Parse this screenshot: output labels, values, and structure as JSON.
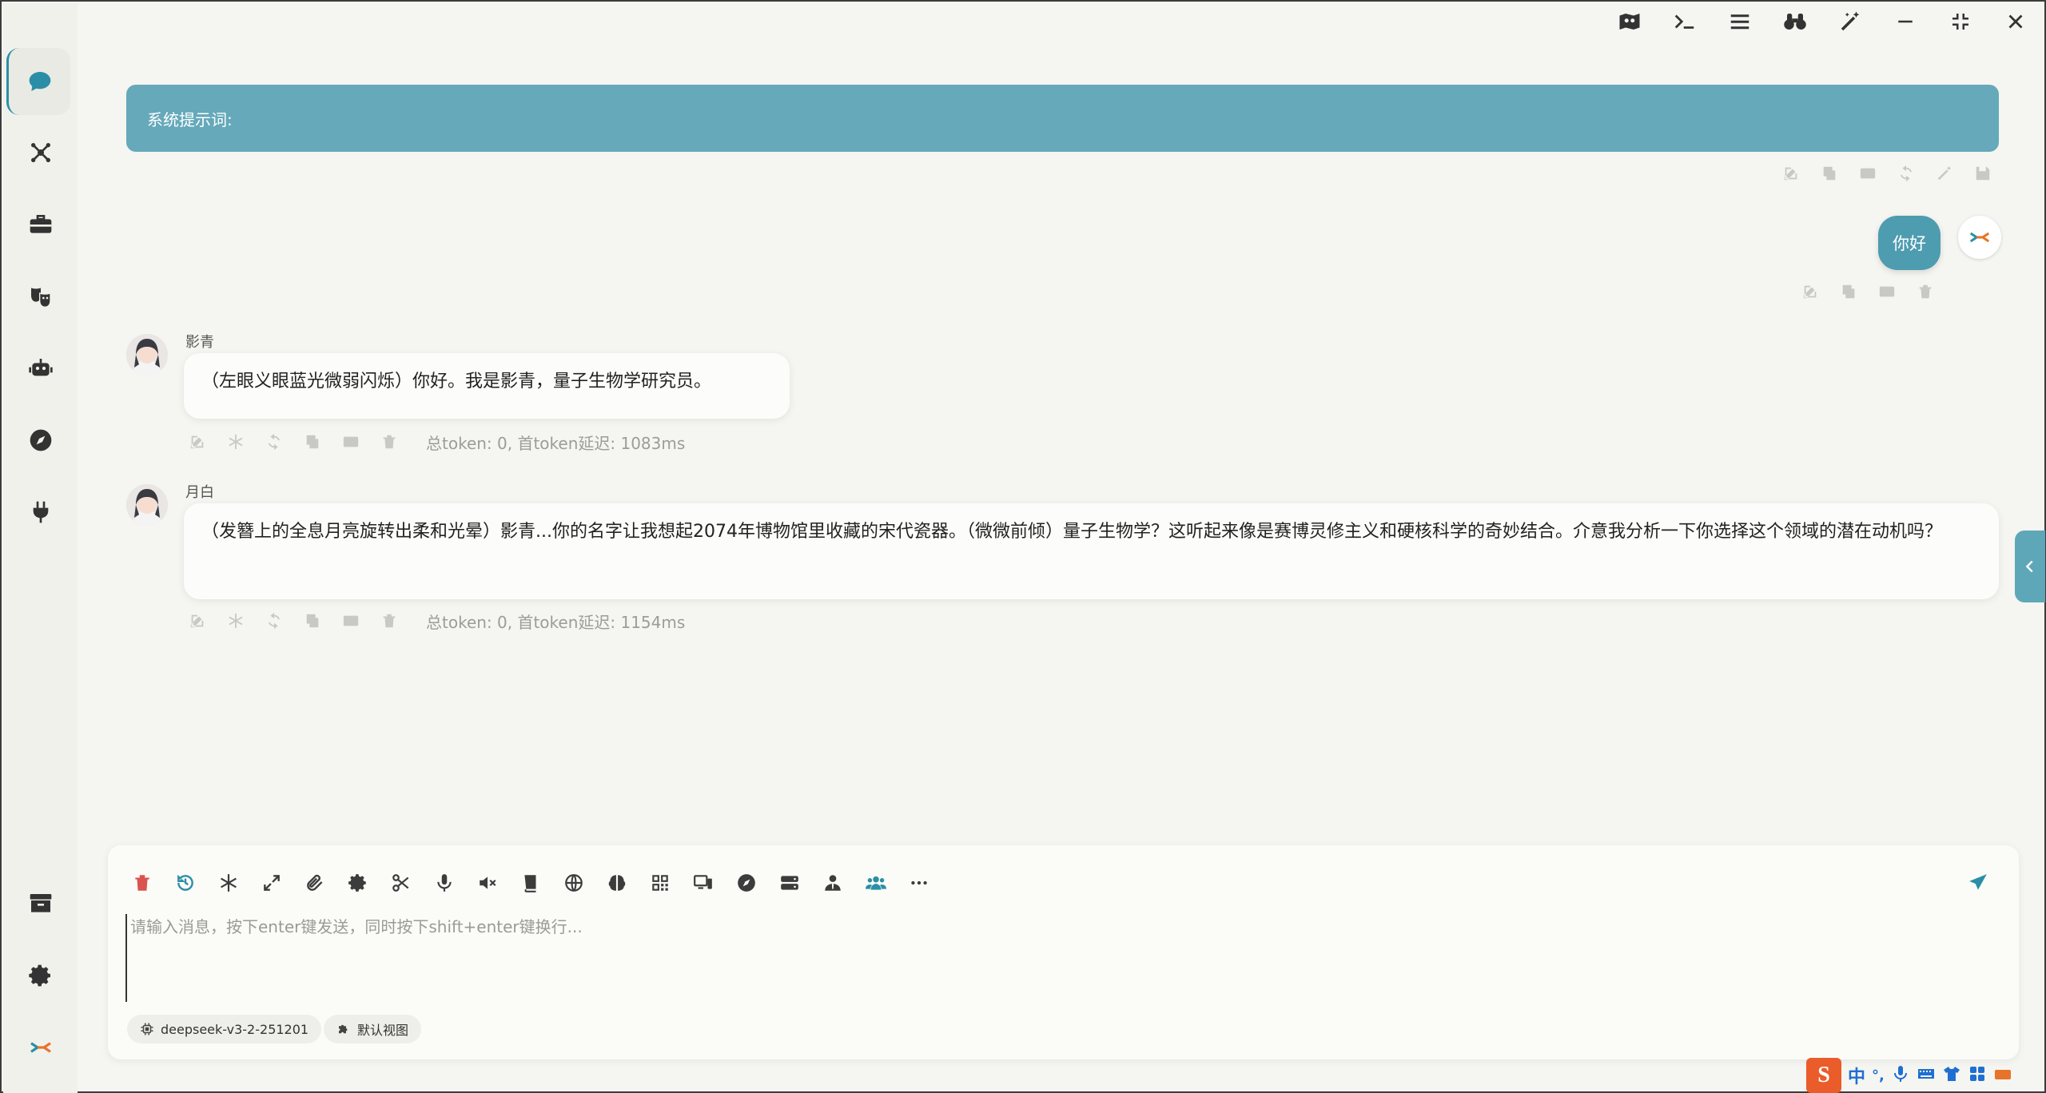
{
  "sidebar": {
    "items": [
      {
        "icon": "chat-bubble-icon",
        "active": true
      },
      {
        "icon": "network-icon"
      },
      {
        "icon": "toolbox-icon"
      },
      {
        "icon": "theater-masks-icon"
      },
      {
        "icon": "robot-icon"
      },
      {
        "icon": "compass-icon"
      },
      {
        "icon": "plug-icon"
      }
    ],
    "bottom": [
      {
        "icon": "archive-icon"
      },
      {
        "icon": "gear-icon"
      },
      {
        "icon": "app-logo-icon"
      }
    ]
  },
  "titlebar": {
    "buttons": [
      "map-icon",
      "terminal-icon",
      "menu-icon",
      "binoculars-icon",
      "magic-wand-icon",
      "minimize-icon",
      "restore-icon",
      "close-icon"
    ]
  },
  "system_prompt": {
    "label": "系统提示词:"
  },
  "user_message": {
    "text": "你好"
  },
  "messages": [
    {
      "name": "影青",
      "text": "（左眼义眼蓝光微弱闪烁）你好。我是影青，量子生物学研究员。",
      "meta": "总token: 0, 首token延迟: 1083ms"
    },
    {
      "name": "月白",
      "text": "（发簪上的全息月亮旋转出柔和光晕）影青...你的名字让我想起2074年博物馆里收藏的宋代瓷器。（微微前倾）量子生物学？这听起来像是赛博灵修主义和硬核科学的奇妙结合。介意我分析一下你选择这个领域的潜在动机吗？",
      "meta": "总token: 0, 首token延迟: 1154ms"
    }
  ],
  "composer": {
    "placeholder": "请输入消息，按下enter键发送，同时按下shift+enter键换行...",
    "value": "",
    "model_chip": "deepseek-v3-2-251201",
    "view_chip": "默认视图"
  },
  "ime": {
    "lang": "中",
    "punct": "°,"
  },
  "colors": {
    "accent": "#2a8fa6",
    "system_bar": "#65a9ba",
    "user_bubble": "#4e9cb0",
    "delete_red": "#d9534f",
    "history_blue": "#2a8fa6",
    "ime_orange": "#ea5c2a"
  }
}
